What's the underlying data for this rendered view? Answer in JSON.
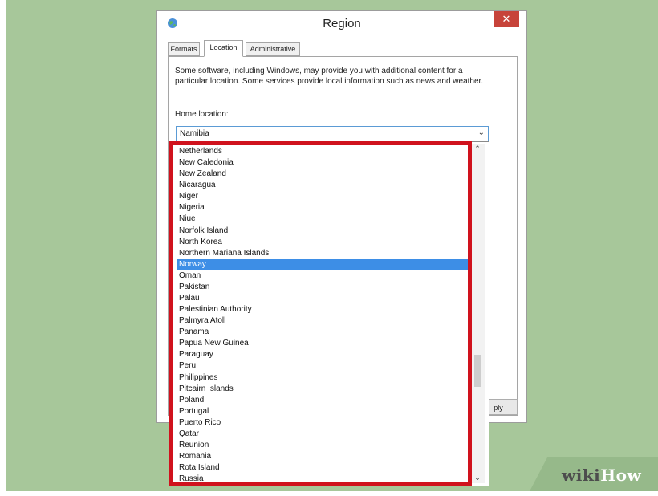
{
  "window": {
    "title": "Region",
    "close_glyph": "✕"
  },
  "tabs": [
    {
      "label": "Formats"
    },
    {
      "label": "Location"
    },
    {
      "label": "Administrative"
    }
  ],
  "active_tab": "Location",
  "location": {
    "description": "Some software, including Windows, may provide you with additional content for a particular location. Some services provide local information such as news and weather.",
    "home_label": "Home location:",
    "home_value": "Namibia"
  },
  "dropdown": {
    "items": [
      "Netherlands",
      "New Caledonia",
      "New Zealand",
      "Nicaragua",
      "Niger",
      "Nigeria",
      "Niue",
      "Norfolk Island",
      "North Korea",
      "Northern Mariana Islands",
      "Norway",
      "Oman",
      "Pakistan",
      "Palau",
      "Palestinian Authority",
      "Palmyra Atoll",
      "Panama",
      "Papua New Guinea",
      "Paraguay",
      "Peru",
      "Philippines",
      "Pitcairn Islands",
      "Poland",
      "Portugal",
      "Puerto Rico",
      "Qatar",
      "Reunion",
      "Romania",
      "Rota Island",
      "Russia"
    ],
    "selected": "Norway"
  },
  "buttons": {
    "apply_partial": "ply"
  },
  "watermark": {
    "wiki": "wiki",
    "how": "How"
  },
  "colors": {
    "highlight": "#d0121d",
    "selection": "#3d8ee6",
    "background": "#a7c79a"
  },
  "icons": {
    "window_icon": "globe-icon",
    "close": "close-icon",
    "combo": "chevron-down-icon"
  }
}
